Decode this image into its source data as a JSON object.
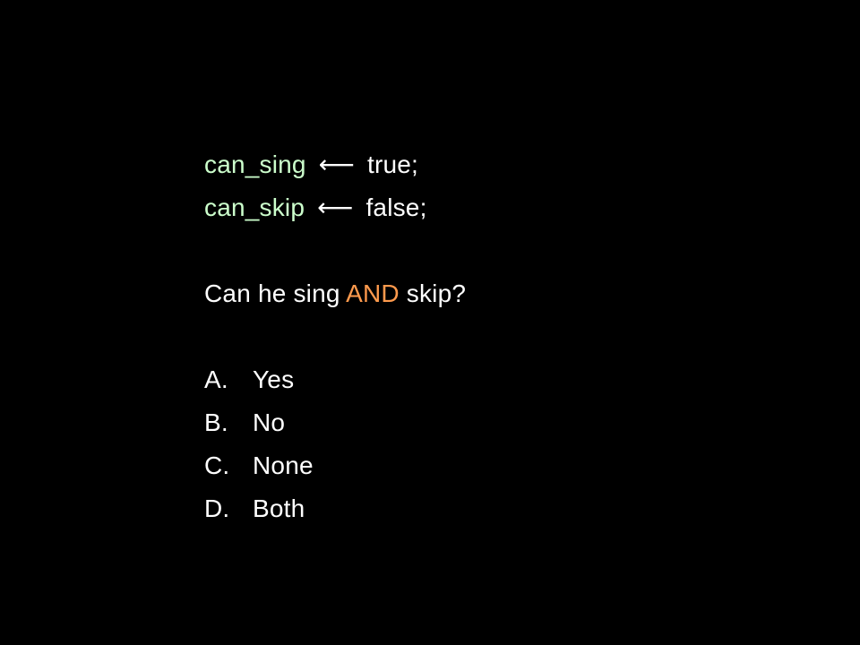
{
  "colors": {
    "background": "#000000",
    "text": "#ffffff",
    "variable": "#ccffcc",
    "operator_keyword": "#ff9a4d"
  },
  "code": [
    {
      "var": "can_sing",
      "arrow": "⟵",
      "value": "true;"
    },
    {
      "var": "can_skip",
      "arrow": "⟵",
      "value": "false;"
    }
  ],
  "question": {
    "prefix": "Can he sing",
    "keyword": "AND",
    "suffix": "skip?"
  },
  "options": [
    {
      "letter": "A.",
      "text": "Yes"
    },
    {
      "letter": "B.",
      "text": "No"
    },
    {
      "letter": "C.",
      "text": "None"
    },
    {
      "letter": "D.",
      "text": "Both"
    }
  ]
}
